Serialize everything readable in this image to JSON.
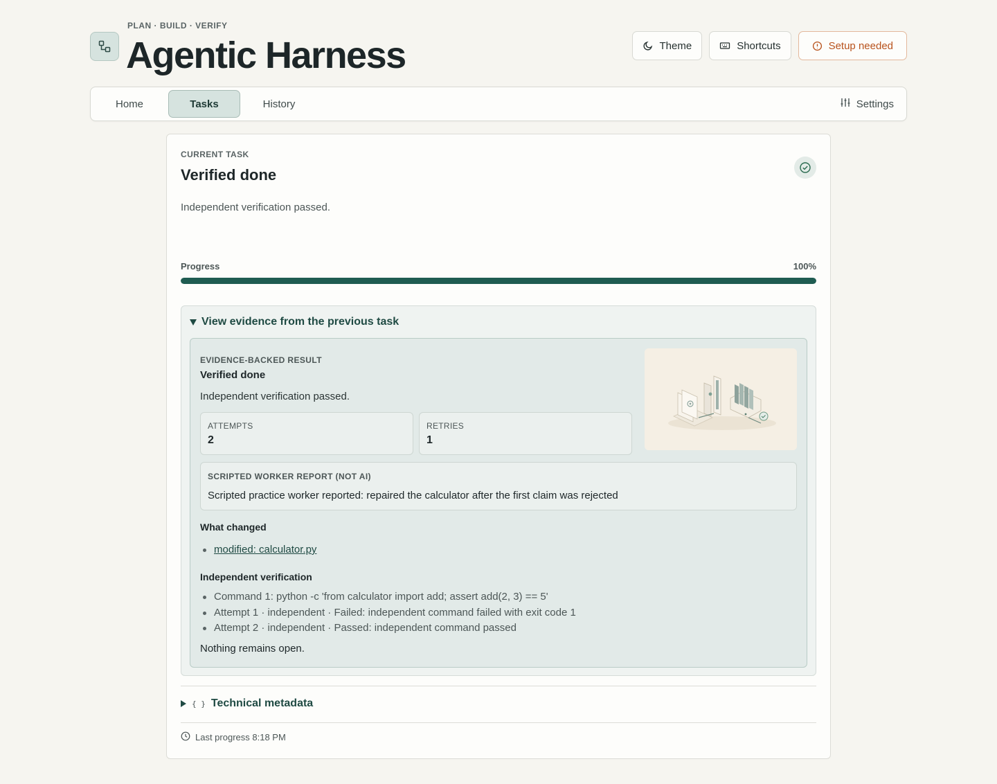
{
  "header": {
    "eyebrow": "PLAN · BUILD · VERIFY",
    "title": "Agentic Harness",
    "actions": {
      "theme": "Theme",
      "shortcuts": "Shortcuts",
      "setup": "Setup needed"
    }
  },
  "nav": {
    "tabs": [
      "Home",
      "Tasks",
      "History"
    ],
    "active": "Tasks",
    "settings": "Settings"
  },
  "task": {
    "eyebrow": "CURRENT TASK",
    "title": "Verified done",
    "description": "Independent verification passed.",
    "progress_label": "Progress",
    "progress_text": "100%",
    "progress_value": 1.0
  },
  "evidence": {
    "summary": "View evidence from the previous task",
    "eyebrow": "EVIDENCE-BACKED RESULT",
    "title": "Verified done",
    "description": "Independent verification passed.",
    "attempts_label": "ATTEMPTS",
    "attempts_value": "2",
    "retries_label": "RETRIES",
    "retries_value": "1",
    "report_label": "SCRIPTED WORKER REPORT (NOT AI)",
    "report_text": "Scripted practice worker reported: repaired the calculator after the first claim was rejected",
    "changes_heading": "What changed",
    "changes": [
      "modified: calculator.py"
    ],
    "verification_heading": "Independent verification",
    "verification": [
      "Command 1: python -c 'from calculator import add; assert add(2, 3) == 5'",
      "Attempt 1 · independent · Failed: independent command failed with exit code 1",
      "Attempt 2 · independent · Passed: independent command passed"
    ],
    "remaining": "Nothing remains open."
  },
  "footer": {
    "technical_metadata": "Technical metadata",
    "last_progress": "Last progress 8:18 PM"
  },
  "colors": {
    "accent": "#1f5c51",
    "warning": "#b8521c",
    "background": "#f6f5f0"
  }
}
